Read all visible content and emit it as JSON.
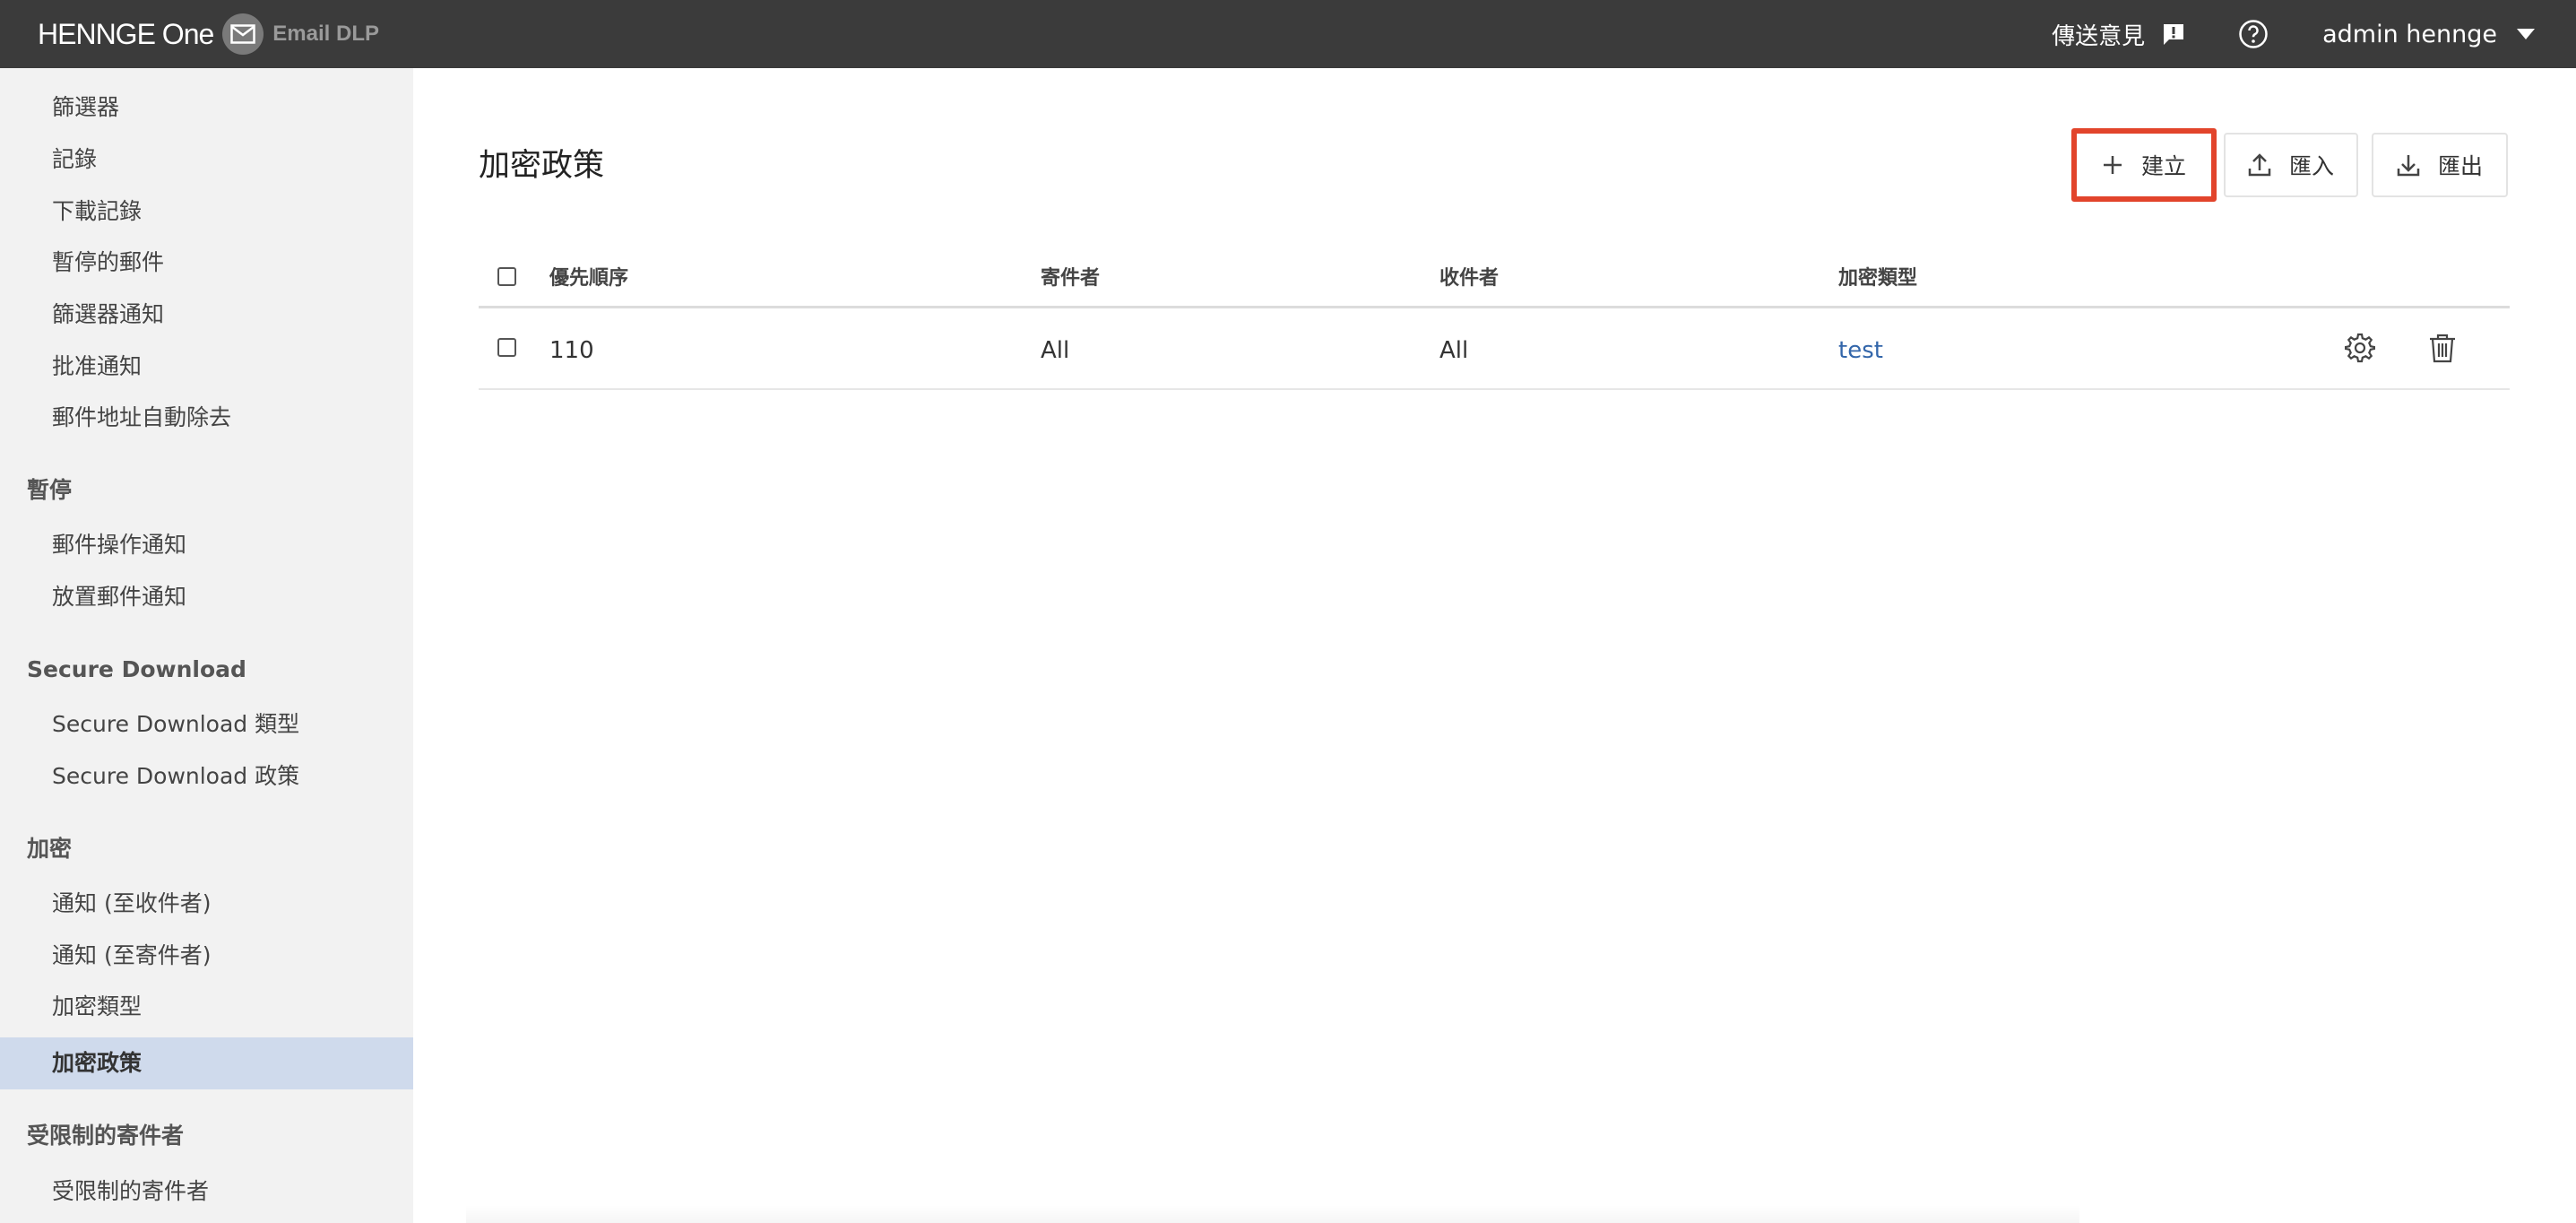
{
  "header": {
    "brand": "HENNGE One",
    "product": "Email DLP",
    "feedback_label": "傳送意見",
    "user_name": "admin hennge"
  },
  "sidebar": {
    "items": [
      {
        "label": "篩選器",
        "type": "item"
      },
      {
        "label": "記錄",
        "type": "item"
      },
      {
        "label": "下載記錄",
        "type": "item"
      },
      {
        "label": "暫停的郵件",
        "type": "item"
      },
      {
        "label": "篩選器通知",
        "type": "item"
      },
      {
        "label": "批准通知",
        "type": "item"
      },
      {
        "label": "郵件地址自動除去",
        "type": "item"
      },
      {
        "label": "暫停",
        "type": "group"
      },
      {
        "label": "郵件操作通知",
        "type": "item"
      },
      {
        "label": "放置郵件通知",
        "type": "item"
      },
      {
        "label": "Secure Download",
        "type": "group"
      },
      {
        "label": "Secure Download 類型",
        "type": "item"
      },
      {
        "label": "Secure Download 政策",
        "type": "item"
      },
      {
        "label": "加密",
        "type": "group"
      },
      {
        "label": "通知 (至收件者)",
        "type": "item"
      },
      {
        "label": "通知 (至寄件者)",
        "type": "item"
      },
      {
        "label": "加密類型",
        "type": "item"
      },
      {
        "label": "加密政策",
        "type": "item",
        "active": true
      },
      {
        "label": "受限制的寄件者",
        "type": "group"
      },
      {
        "label": "受限制的寄件者",
        "type": "item"
      }
    ]
  },
  "main": {
    "title": "加密政策",
    "actions": {
      "create_label": "建立",
      "import_label": "匯入",
      "export_label": "匯出"
    },
    "table": {
      "columns": [
        "優先順序",
        "寄件者",
        "收件者",
        "加密類型"
      ],
      "rows": [
        {
          "priority": "110",
          "sender": "All",
          "recipient": "All",
          "encryption_type": "test"
        }
      ]
    }
  },
  "colors": {
    "topbar": "#3b3b3b",
    "sidebar_bg": "#f2f2f2",
    "active_item_bg": "#cfdaec",
    "highlight_border": "#e2442b",
    "link": "#3366aa"
  },
  "icons": [
    "mail-icon",
    "feedback-icon",
    "help-icon",
    "caret-down-icon",
    "plus-icon",
    "upload-icon",
    "download-icon",
    "gear-icon",
    "trash-icon"
  ]
}
